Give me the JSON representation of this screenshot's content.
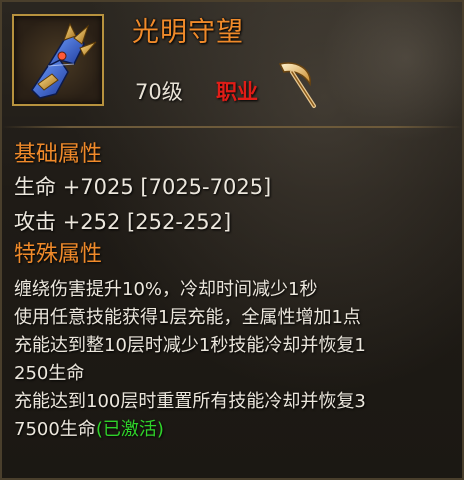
{
  "item": {
    "name": "光明守望",
    "level": "70级",
    "class_label": "职业"
  },
  "sections": {
    "basic_title": "基础属性",
    "basic_stats": [
      {
        "label": "生命",
        "value": "+7025 [7025-7025]"
      },
      {
        "label": "攻击",
        "value": "+252 [252-252]"
      }
    ],
    "special_title": "特殊属性",
    "special_lines": [
      "缠绕伤害提升10%，冷却时间减少1秒",
      "使用任意技能获得1层充能，全属性增加1点",
      "充能达到整10层时减少1秒技能冷却并恢复1",
      "250生命",
      "充能达到100层时重置所有技能冷却并恢复3",
      "7500生命"
    ],
    "activated_label": "(已激活)"
  },
  "colors": {
    "name_orange": "#f08a2a",
    "class_red": "#e11d17",
    "activated_green": "#2fd32a",
    "frame_gold": "#b7923e"
  },
  "icons": {
    "item_icon": "gauntlet-icon",
    "class_icon": "scythe-icon"
  }
}
